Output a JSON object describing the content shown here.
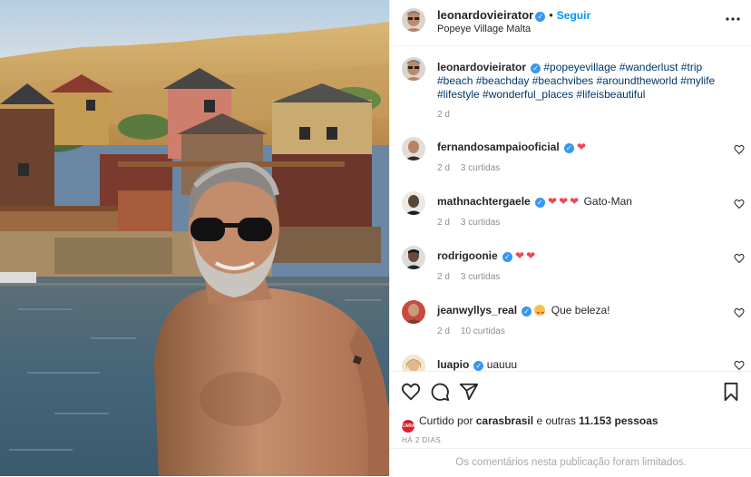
{
  "post": {
    "author": "leonardovieirator",
    "follow_label": "Seguir",
    "location": "Popeye Village Malta",
    "caption_tags": "#popeyevillage #wanderlust #trip #beach #beachday #beachvibes #aroundtheworld #mylife #lifestyle #wonderful_places #lifeisbeautiful",
    "caption_time": "2 d"
  },
  "comments": [
    {
      "user": "fernandosampaiooficial",
      "text": "",
      "emoji": "heart",
      "time": "2 d",
      "replies": "3 curtidas"
    },
    {
      "user": "mathnachtergaele",
      "text": "Gato-Man",
      "emoji": "hearts3",
      "time": "2 d",
      "replies": "3 curtidas"
    },
    {
      "user": "rodrigoonie",
      "text": "",
      "emoji": "hearts2",
      "time": "2 d",
      "replies": "3 curtidas"
    },
    {
      "user": "jeanwyllys_real",
      "text": "Que beleza!",
      "emoji": "heart-eyes",
      "time": "2 d",
      "replies": "10 curtidas"
    },
    {
      "user": "luapio",
      "text": "uauuu",
      "emoji": "",
      "time": "",
      "replies": ""
    }
  ],
  "likes": {
    "by_user": "carasbrasil",
    "prefix": "Curtido por",
    "suffix": "e outras",
    "count": "11.153",
    "unit": "pessoas",
    "mini_avatar_text": "CARAS"
  },
  "time_ago": "HÁ 2 DIAS",
  "comments_limited": "Os comentários nesta publicação foram limitados.",
  "icons": [
    "more-options-icon",
    "heart-icon",
    "comment-icon",
    "share-icon",
    "bookmark-icon",
    "verified-icon"
  ],
  "colors": {
    "accent": "#0095f6",
    "heart": "#ed4956",
    "verified": "#3897f0",
    "muted": "#8e8e8e"
  }
}
